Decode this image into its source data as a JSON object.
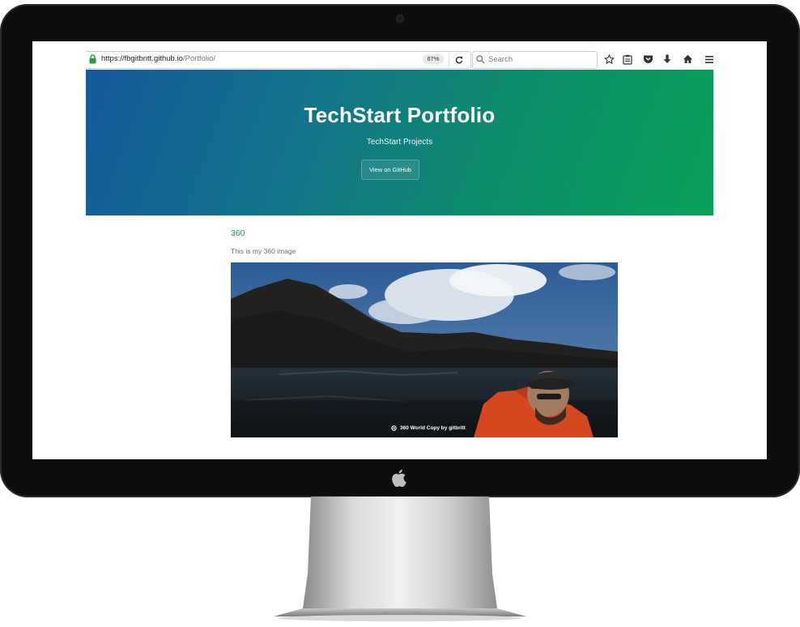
{
  "browser": {
    "url_host": "https://fbgitbritt.github.io",
    "url_path": "/Portfolio/",
    "zoom": "67%",
    "search_placeholder": "Search",
    "toolbar_icons": [
      "reload-icon",
      "star-icon",
      "reader-list-icon",
      "pocket-icon",
      "download-icon",
      "home-icon",
      "menu-icon"
    ]
  },
  "hero": {
    "title": "TechStart Portfolio",
    "subtitle": "TechStart Projects",
    "github_button": "View on GitHub"
  },
  "content": {
    "heading": "360",
    "description": "This is my 360 image",
    "viewer_credit": "360 World Copy by gitbritt"
  },
  "colors": {
    "hero_gradient_start": "#155a9c",
    "hero_gradient_end": "#0aa058",
    "heading": "#159957",
    "body_text": "#606c71",
    "bezel": "#0d0d0d"
  }
}
